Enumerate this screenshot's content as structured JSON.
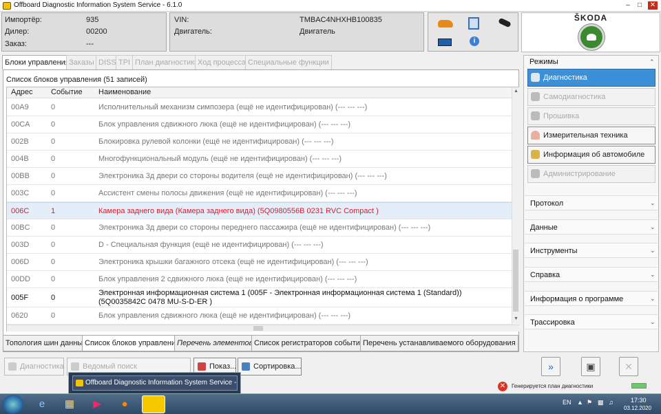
{
  "window": {
    "title": "Offboard Diagnostic Information System Service - 6.1.0"
  },
  "header": {
    "importer_label": "Импортёр:",
    "importer_value": "935",
    "dealer_label": "Дилер:",
    "dealer_value": "00200",
    "order_label": "Заказ:",
    "order_value": "---",
    "vin_label": "VIN:",
    "vin_value": "TMBAC4NHXHB100835",
    "engine_label": "Двигатель:",
    "engine_value": "Двигатель"
  },
  "logo": {
    "brand": "ŠKODA"
  },
  "tabs": [
    {
      "label": "Блоки управления",
      "active": true
    },
    {
      "label": "Заказы"
    },
    {
      "label": "DISS"
    },
    {
      "label": "TPI"
    },
    {
      "label": "План диагностики"
    },
    {
      "label": "Ход процесса"
    },
    {
      "label": "Специальные функции"
    }
  ],
  "panel": {
    "title": "Список блоков управления (51 записей)",
    "columns": [
      "Адрес",
      "Событие",
      "Наименование"
    ],
    "rows": [
      {
        "addr": "00A9",
        "event": "0",
        "name": "Исполнительный механизм симпозера (ещё не идентифицирован) (---   ---   ---)"
      },
      {
        "addr": "00CA",
        "event": "0",
        "name": "Блок управления сдвижного люка (ещё не идентифицирован) (---   ---   ---)"
      },
      {
        "addr": "002B",
        "event": "0",
        "name": "Блокировка рулевой колонки (ещё не идентифицирован) (---   ---   ---)"
      },
      {
        "addr": "004B",
        "event": "0",
        "name": "Многофункциональный модуль (ещё не идентифицирован) (---   ---   ---)"
      },
      {
        "addr": "00BB",
        "event": "0",
        "name": "Электроника 3д двери со стороны водителя (ещё не идентифицирован) (---   ---   ---)"
      },
      {
        "addr": "003C",
        "event": "0",
        "name": "Ассистент смены полосы движения (ещё не идентифицирован) (---   ---   ---)"
      },
      {
        "addr": "006C",
        "event": "1",
        "name": "Камера заднего вида (Камера заднего вида) (5Q0980556B    0231   RVC Compact  )"
      },
      {
        "addr": "00BC",
        "event": "0",
        "name": "Электроника 3д двери со стороны переднего пассажира (ещё не идентифицирован) (---   ---   ---)"
      },
      {
        "addr": "003D",
        "event": "0",
        "name": "D - Специальная функция (ещё не идентифицирован) (---   ---   ---)"
      },
      {
        "addr": "006D",
        "event": "0",
        "name": "Электроника крышки багажного отсека (ещё не идентифицирован) (---   ---   ---)"
      },
      {
        "addr": "00DD",
        "event": "0",
        "name": "Блок управления 2 сдвижного люка (ещё не идентифицирован) (---   ---   ---)"
      },
      {
        "addr": "005F",
        "event": "0",
        "name": "Электронная информационная система 1 (005F - Электронная информационная система 1 (Standard)) (5Q0035842C    0478   MU-S-D-ER   )"
      },
      {
        "addr": "0620",
        "event": "0",
        "name": "Блок управления сдвижного люка (ещё не идентифицирован) (---   ---   ---)"
      }
    ]
  },
  "bottom_tabs": [
    {
      "label": "Топология шин данных"
    },
    {
      "label": "Список блоков управления",
      "active": true
    },
    {
      "label": "Перечень элементов"
    },
    {
      "label": "Список регистраторов событий"
    },
    {
      "label": "Перечень устанавливаемого оборудования"
    }
  ],
  "actions": {
    "diagnostics": "Диагностика",
    "guided_search": "Ведомый поиск неисправностей",
    "show": "Показ...",
    "sort": "Сортировка..."
  },
  "sidebar": {
    "modes_title": "Режимы",
    "modes": [
      {
        "label": "Диагностика",
        "state": "active"
      },
      {
        "label": "Самодиагностика",
        "state": "disabled"
      },
      {
        "label": "Прошивка",
        "state": "disabled"
      },
      {
        "label": "Измерительная техника",
        "state": "enabled"
      },
      {
        "label": "Информация об автомобиле",
        "state": "enabled"
      },
      {
        "label": "Администрирование",
        "state": "disabled"
      }
    ],
    "sections": [
      "Протокол",
      "Данные",
      "Инструменты",
      "Справка",
      "Информация о программе",
      "Трассировка"
    ]
  },
  "popup": {
    "label": "Offboard Diagnostic Information System Service - 6.1.0"
  },
  "status": {
    "text": "Генерируется план диагностики"
  },
  "taskbar": {
    "lang": "EN",
    "time": "17:30",
    "date": "03.12.2020"
  },
  "colors": {
    "selected_text": "#e0192e",
    "active_mode": "#3d8fd6",
    "skoda_green": "#3b8a2f"
  }
}
